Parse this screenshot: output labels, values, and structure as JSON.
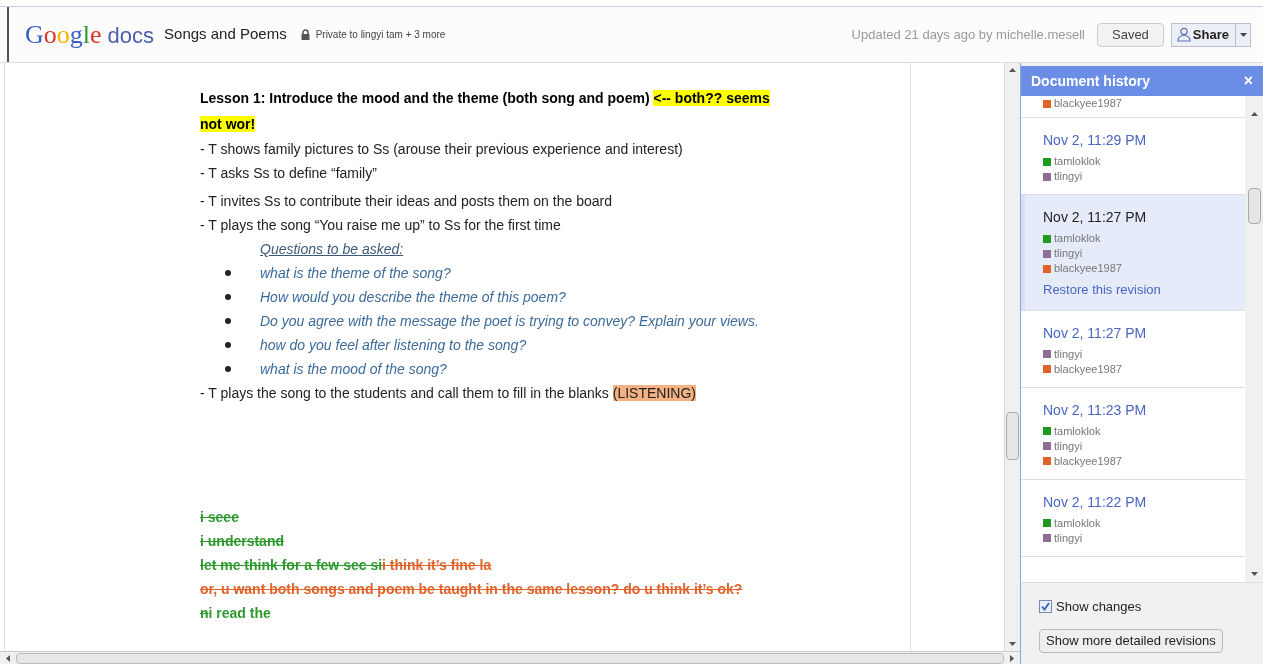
{
  "header": {
    "logo": {
      "brand": "Google",
      "product": "docs"
    },
    "title": "Songs and Poems",
    "privacy": "Private to lingyi tam + 3 more",
    "updated": "Updated 21 days ago by michelle.mesell",
    "saved_button": "Saved",
    "share_button": "Share"
  },
  "document": {
    "lines": [
      {
        "kind": "heading",
        "runs": [
          {
            "text": "Lesson 1: Introduce the mood and the theme (both song and poem) "
          },
          {
            "text": "<-- both?? seems not wor!",
            "kind": "highlight",
            "color": "#ffff00"
          }
        ]
      },
      {
        "kind": "plain",
        "runs": [
          {
            "text": "- T shows family pictures to Ss (arouse their previous experience and interest)"
          }
        ]
      },
      {
        "kind": "plain",
        "runs": [
          {
            "text": "- T asks Ss to define “family”"
          }
        ]
      },
      {
        "kind": "plain",
        "runs": [
          {
            "text": "- T invites Ss to contribute their ideas and posts them on the board"
          }
        ]
      },
      {
        "kind": "plain",
        "runs": [
          {
            "text": "- T plays the song “You raise me up” to Ss for the first time"
          }
        ]
      },
      {
        "kind": "subheading",
        "runs": [
          {
            "text": "Questions to be asked:"
          }
        ]
      },
      {
        "kind": "bullet",
        "runs": [
          {
            "text": "what is the theme of the song?"
          }
        ]
      },
      {
        "kind": "bullet",
        "runs": [
          {
            "text": "How would you describe the theme of this poem?"
          }
        ]
      },
      {
        "kind": "bullet",
        "runs": [
          {
            "text": " Do you agree with the message the poet is trying to convey? Explain your views."
          }
        ]
      },
      {
        "kind": "bullet",
        "runs": [
          {
            "text": "how do you feel after listening to the song?"
          }
        ]
      },
      {
        "kind": "bullet",
        "runs": [
          {
            "text": "what is the mood of the song?"
          }
        ]
      },
      {
        "kind": "plain",
        "runs": [
          {
            "text": "- T plays the song to the students and call them to fill in the blanks "
          },
          {
            "text": "(LISTENING)",
            "kind": "highlight",
            "color": "#f4b183"
          }
        ]
      },
      {
        "kind": "change",
        "runs": [
          {
            "text": "i seee",
            "color": "#2e9a2e",
            "strike": true
          }
        ]
      },
      {
        "kind": "change",
        "runs": [
          {
            "text": "i understand",
            "color": "#2e9a2e",
            "strike": true
          }
        ]
      },
      {
        "kind": "change",
        "runs": [
          {
            "text": "let me think for a few sec si",
            "color": "#2e9a2e",
            "strike": true
          },
          {
            "text": "i think it’s fine la",
            "color": "#e0632a",
            "strike": true
          }
        ]
      },
      {
        "kind": "change",
        "runs": [
          {
            "text": "or, u want both songs and poem be taught in the same lesson? do u think it’s ok?",
            "color": "#e0632a",
            "strike": true
          }
        ]
      },
      {
        "kind": "change",
        "runs": [
          {
            "text": "n",
            "color": "#2e9a2e",
            "strike": true
          },
          {
            "text": "i read the",
            "color": "#2e9a2e",
            "strike": false
          }
        ]
      }
    ]
  },
  "history": {
    "title": "Document history",
    "close": "×",
    "entries": [
      {
        "authors": [
          {
            "name": "blackyee1987",
            "color": "#e0632a"
          }
        ],
        "selected": false
      },
      {
        "time": "Nov 2, 11:29 PM",
        "selected": false,
        "authors": [
          {
            "name": "tamloklok",
            "color": "#1e9a1e"
          },
          {
            "name": "tlingyi",
            "color": "#8e6e96"
          }
        ]
      },
      {
        "time": "Nov 2, 11:27 PM",
        "selected": true,
        "authors": [
          {
            "name": "tamloklok",
            "color": "#1e9a1e"
          },
          {
            "name": "tlingyi",
            "color": "#8e6e96"
          },
          {
            "name": "blackyee1987",
            "color": "#e0632a"
          }
        ],
        "restore": "Restore this revision"
      },
      {
        "time": "Nov 2, 11:27 PM",
        "selected": false,
        "authors": [
          {
            "name": "tlingyi",
            "color": "#8e6e96"
          },
          {
            "name": "blackyee1987",
            "color": "#e0632a"
          }
        ]
      },
      {
        "time": "Nov 2, 11:23 PM",
        "selected": false,
        "authors": [
          {
            "name": "tamloklok",
            "color": "#1e9a1e"
          },
          {
            "name": "tlingyi",
            "color": "#8e6e96"
          },
          {
            "name": "blackyee1987",
            "color": "#e0632a"
          }
        ]
      },
      {
        "time": "Nov 2, 11:22 PM",
        "selected": false,
        "authors": [
          {
            "name": "tamloklok",
            "color": "#1e9a1e"
          },
          {
            "name": "tlingyi",
            "color": "#8e6e96"
          }
        ]
      }
    ],
    "show_changes": {
      "label": "Show changes",
      "checked": true
    },
    "detail_button": "Show more detailed revisions"
  }
}
